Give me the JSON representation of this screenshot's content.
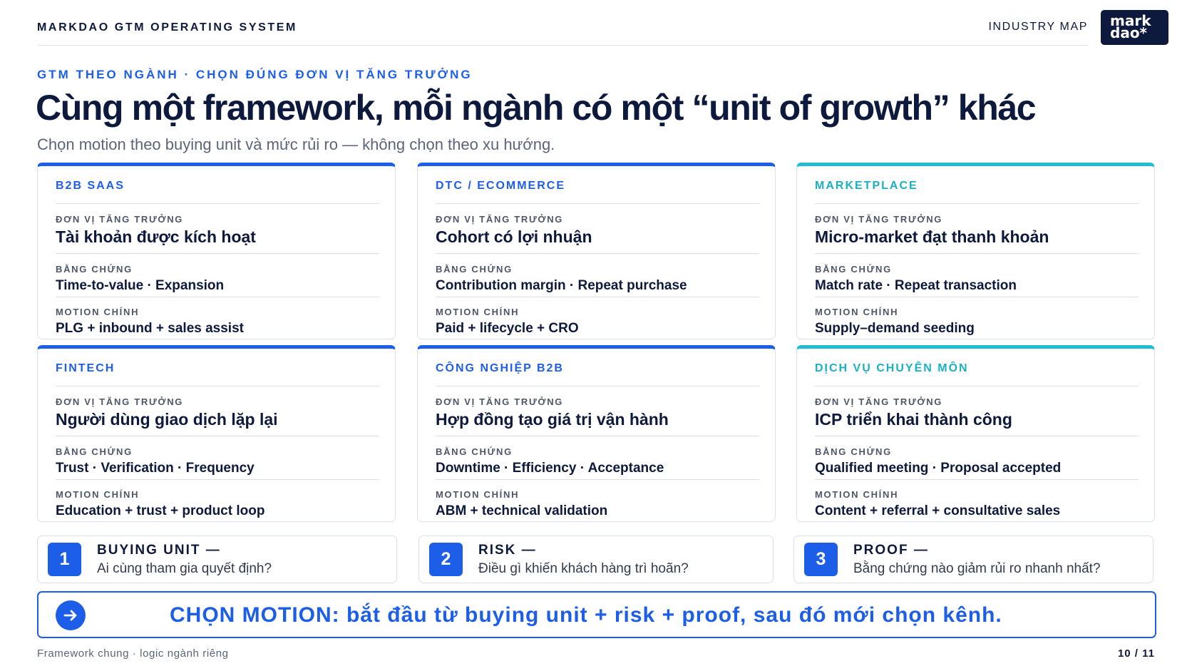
{
  "header": {
    "brand_title": "MARKDAO GTM OPERATING SYSTEM",
    "section_tag": "INDUSTRY MAP",
    "logo_line1": "mark",
    "logo_line2": "dao*"
  },
  "hero": {
    "eyebrow": "GTM THEO NGÀNH · CHỌN ĐÚNG ĐƠN VỊ TĂNG TRƯỞNG",
    "title": "Cùng một framework, mỗi ngành có một “unit of growth” khác",
    "subtitle": "Chọn motion theo buying unit và mức rủi ro — không chọn theo xu hướng."
  },
  "labels": {
    "unit": "ĐƠN VỊ TĂNG TRƯỞNG",
    "proof": "BẰNG CHỨNG",
    "motion": "MOTION CHÍNH"
  },
  "industries": [
    {
      "name": "B2B SAAS",
      "unit": "Tài khoản được kích hoạt",
      "proof": "Time-to-value · Expansion",
      "motion": "PLG + inbound + sales assist",
      "accent": "#1d5ee8"
    },
    {
      "name": "DTC / ECOMMERCE",
      "unit": "Cohort có lợi nhuận",
      "proof": "Contribution margin · Repeat purchase",
      "motion": "Paid + lifecycle + CRO",
      "accent": "#1d5ee8"
    },
    {
      "name": "MARKETPLACE",
      "unit": "Micro-market đạt thanh khoản",
      "proof": "Match rate · Repeat transaction",
      "motion": "Supply–demand seeding",
      "accent": "#22bccf"
    },
    {
      "name": "FINTECH",
      "unit": "Người dùng giao dịch lặp lại",
      "proof": "Trust · Verification · Frequency",
      "motion": "Education + trust + product loop",
      "accent": "#1d5ee8"
    },
    {
      "name": "CÔNG NGHIỆP B2B",
      "unit": "Hợp đồng tạo giá trị vận hành",
      "proof": "Downtime · Efficiency · Acceptance",
      "motion": "ABM + technical validation",
      "accent": "#1d5ee8"
    },
    {
      "name": "DỊCH VỤ CHUYÊN MÔN",
      "unit": "ICP triển khai thành công",
      "proof": "Qualified meeting · Proposal accepted",
      "motion": "Content + referral + consultative sales",
      "accent": "#22bccf"
    }
  ],
  "questions": [
    {
      "number": "1",
      "title": "BUYING UNIT —",
      "desc": "Ai cùng tham gia quyết định?"
    },
    {
      "number": "2",
      "title": "RISK —",
      "desc": "Điều gì khiến khách hàng trì hoãn?"
    },
    {
      "number": "3",
      "title": "PROOF —",
      "desc": "Bằng chứng nào giảm rủi ro nhanh nhất?"
    }
  ],
  "cta": {
    "icon": "arrow-right-circle-icon",
    "text": "CHỌN MOTION: bắt đầu từ buying unit + risk + proof, sau đó mới chọn kênh."
  },
  "footer": {
    "left": "Framework chung · logic ngành riêng",
    "page": "10 / 11"
  },
  "colors": {
    "navy": "#0e1a3d",
    "blue": "#1d5ee8",
    "teal": "#22bccf"
  }
}
